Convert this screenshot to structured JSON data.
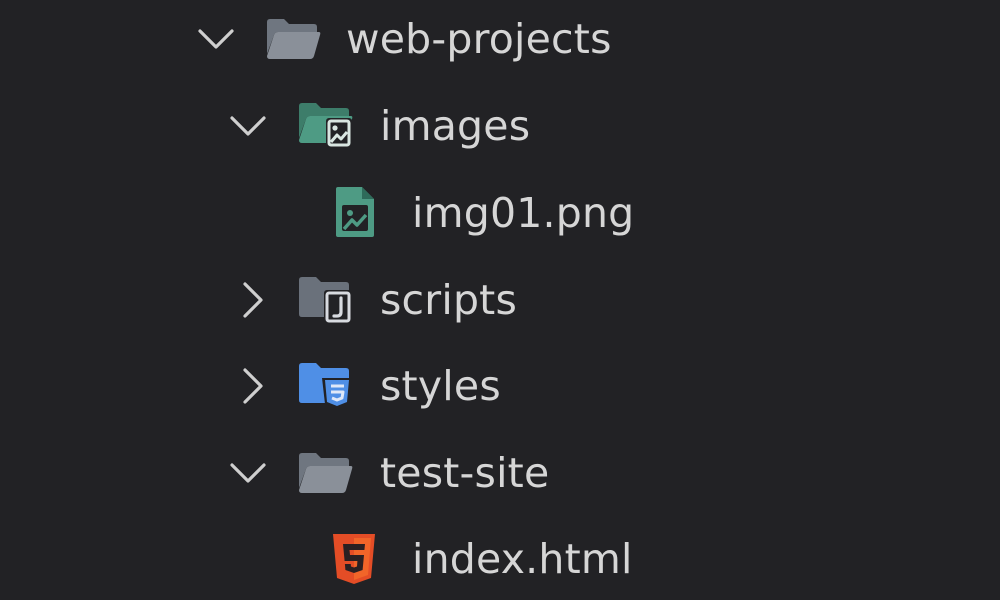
{
  "explorer": {
    "items": [
      {
        "label": "web-projects",
        "icon": "folder-open-icon",
        "chevron": "chevron-down-icon",
        "expanded": true
      },
      {
        "label": "images",
        "icon": "images-folder-icon",
        "chevron": "chevron-down-icon",
        "expanded": true
      },
      {
        "label": "img01.png",
        "icon": "image-file-icon"
      },
      {
        "label": "scripts",
        "icon": "scripts-folder-icon",
        "chevron": "chevron-right-icon",
        "expanded": false
      },
      {
        "label": "styles",
        "icon": "styles-folder-icon",
        "chevron": "chevron-right-icon",
        "expanded": false
      },
      {
        "label": "test-site",
        "icon": "folder-open-icon",
        "chevron": "chevron-down-icon",
        "expanded": true
      },
      {
        "label": "index.html",
        "icon": "html5-icon"
      }
    ]
  },
  "colors": {
    "background": "#222225",
    "text": "#d6d6d6",
    "chevron": "#cfcfcf",
    "folder_gray": "#8a9099",
    "folder_dark_gray": "#6a717b",
    "images_green": "#4e9b84",
    "styles_blue": "#4f8fe6",
    "html_orange": "#e44d26"
  }
}
